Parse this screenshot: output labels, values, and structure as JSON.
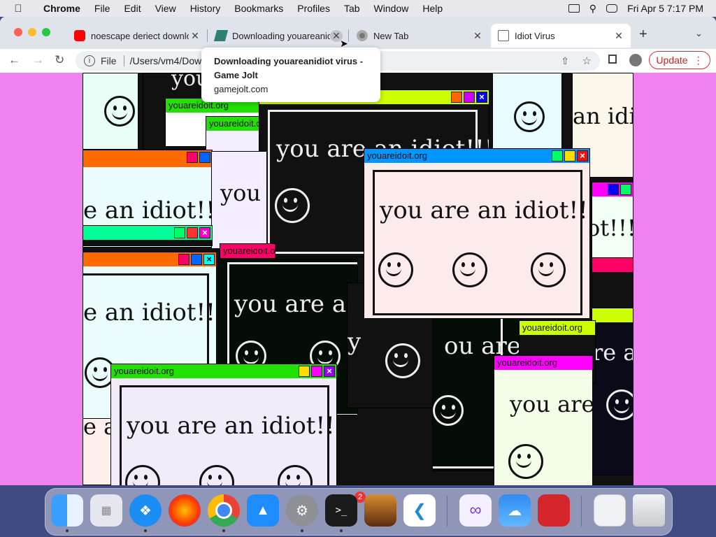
{
  "menubar": {
    "app_name": "Chrome",
    "items": [
      "File",
      "Edit",
      "View",
      "History",
      "Bookmarks",
      "Profiles",
      "Tab",
      "Window",
      "Help"
    ],
    "datetime": "Fri Apr 5  7:17 PM"
  },
  "tabs": [
    {
      "title": "noescape deriect downlo",
      "favicon": "youtube-icon",
      "active": false
    },
    {
      "title": "Downloading youareanidi",
      "favicon": "gamejolt-icon",
      "active": false
    },
    {
      "title": "New Tab",
      "favicon": "chrome-icon",
      "active": false
    },
    {
      "title": "Idiot Virus",
      "favicon": "page-icon",
      "active": true
    }
  ],
  "tooltip": {
    "title": "Downloading youareanidiot virus - Game Jolt",
    "host": "gamejolt.com"
  },
  "toolbar": {
    "scheme": "File",
    "url": "/Users/vm4/Dow",
    "update_label": "Update"
  },
  "page": {
    "window_title": "youareidoit.org",
    "message": "you are an idiot!!!",
    "fragments": {
      "f1": "you a",
      "f2": "an idi",
      "f3": "e an idiot!!",
      "f4": "youareidoit.org",
      "f5": "you",
      "f6": "youareidoit.org",
      "f7": "you are an idiot!!!",
      "f8": "e an idiot!!!",
      "f9": "you are an i",
      "f10": "ot!!!",
      "f11": "ou are",
      "f12": "youareidoit.org",
      "f13": "youareidoit.org",
      "f14": "you are",
      "f15": "e a",
      "f16": "re a",
      "f17": "y",
      "f18": "youareidoit.org"
    }
  },
  "dock": {
    "apps": [
      "Finder",
      "Launchpad",
      "Safari",
      "Firefox",
      "Chrome",
      "App Store",
      "System Settings",
      "Terminal",
      "GarageBand",
      "Visual Studio Code",
      "Visual Studio",
      "Weather",
      "Photo Booth",
      "Downloads",
      "Trash"
    ],
    "settings_badge": "2"
  }
}
